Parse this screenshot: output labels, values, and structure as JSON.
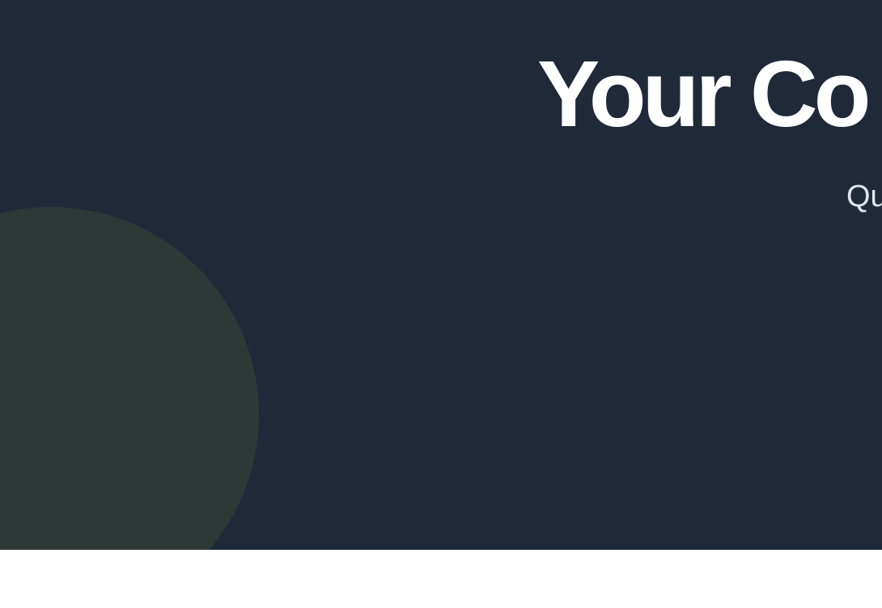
{
  "hero": {
    "title": "Your Co",
    "subtitle": "Qu"
  },
  "colors": {
    "hero_background": "#202938",
    "decorative_circle": "#2e3937",
    "title_text": "#ffffff",
    "subtitle_text": "#dfe3ea",
    "page_background": "#ffffff"
  }
}
